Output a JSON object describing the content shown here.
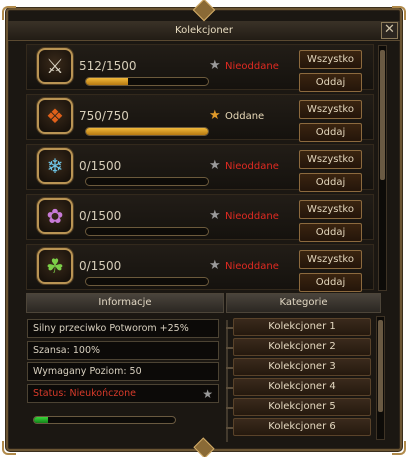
{
  "window": {
    "title": "Kolekcjoner",
    "close_label": "✕"
  },
  "buttons": {
    "all_label": "Wszystko",
    "submit_label": "Oddaj"
  },
  "collections": [
    {
      "icon": "sword-bundle-icon",
      "glyph": "⚔",
      "glyph_color": "#d8d2c2",
      "count": "512/1500",
      "progress": 0.341,
      "status": "Nieoddane",
      "status_color": "#e02a22",
      "star_color": "#9a9a9a",
      "submitted": false
    },
    {
      "icon": "fire-crystal-icon",
      "glyph": "❖",
      "glyph_color": "#e0601a",
      "count": "750/750",
      "progress": 1.0,
      "status": "Oddane",
      "status_color": "#e8d9b8",
      "star_color": "#e09a2a",
      "submitted": true
    },
    {
      "icon": "blue-crystal-icon",
      "glyph": "❄",
      "glyph_color": "#6ec6e8",
      "count": "0/1500",
      "progress": 0,
      "status": "Nieoddane",
      "status_color": "#e02a22",
      "star_color": "#9a9a9a",
      "submitted": false
    },
    {
      "icon": "purple-flower-icon",
      "glyph": "✿",
      "glyph_color": "#c87ad8",
      "count": "0/1500",
      "progress": 0,
      "status": "Nieoddane",
      "status_color": "#e02a22",
      "star_color": "#9a9a9a",
      "submitted": false
    },
    {
      "icon": "green-herb-icon",
      "glyph": "☘",
      "glyph_color": "#7ccf48",
      "count": "0/1500",
      "progress": 0,
      "status": "Nieoddane",
      "status_color": "#e02a22",
      "star_color": "#9a9a9a",
      "submitted": false
    }
  ],
  "info": {
    "header": "Informacje",
    "bonus": "Silny przeciwko Potworom +25%",
    "chance": "Szansa: 100%",
    "level": "Wymagany Poziom: 50",
    "status": "Status: Nieukończone",
    "progress": 0.1
  },
  "categories": {
    "header": "Kategorie",
    "items": [
      "Kolekcjoner 1",
      "Kolekcjoner 2",
      "Kolekcjoner 3",
      "Kolekcjoner 4",
      "Kolekcjoner 5",
      "Kolekcjoner 6"
    ]
  },
  "colors": {
    "accent_gold": "#b99454",
    "status_red": "#e02a22",
    "progress_gold": "#f0b93a",
    "progress_green": "#39d63a"
  }
}
